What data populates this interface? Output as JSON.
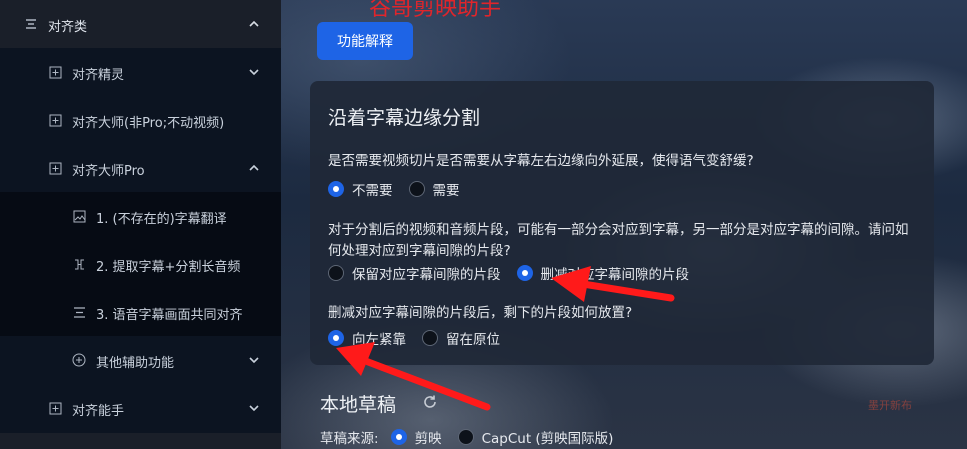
{
  "sidebar": {
    "group": {
      "label": "对齐类",
      "icon": "list-icon"
    },
    "items": [
      {
        "label": "对齐精灵",
        "icon": "plus-box-icon",
        "chevron": "down"
      },
      {
        "label": "对齐大师(非Pro;不动视频)",
        "icon": "plus-box-icon",
        "chevron": ""
      },
      {
        "label": "对齐大师Pro",
        "icon": "plus-box-icon",
        "chevron": "up"
      },
      {
        "label": "1. (不存在的)字幕翻译",
        "icon": "image-icon",
        "chevron": ""
      },
      {
        "label": "2. 提取字幕+分割长音频",
        "icon": "scissors-icon",
        "chevron": ""
      },
      {
        "label": "3. 语音字幕画面共同对齐",
        "icon": "align-icon",
        "chevron": ""
      },
      {
        "label": "其他辅助功能",
        "icon": "plus-circle-icon",
        "chevron": "down"
      },
      {
        "label": "对齐能手",
        "icon": "plus-box-icon",
        "chevron": "down"
      }
    ]
  },
  "main": {
    "watermark": "谷哥剪映助手",
    "explain_button": "功能解释",
    "card": {
      "title": "沿着字幕边缘分割",
      "q1": "是否需要视频切片是否需要从字幕左右边缘向外延展，使得语气变舒缓?",
      "q1_options": [
        "不需要",
        "需要"
      ],
      "q1_selected": 0,
      "q2": "对于分割后的视频和音频片段，可能有一部分会对应到字幕，另一部分是对应字幕的间隙。请问如何处理对应到字幕间隙的片段?",
      "q2_options": [
        "保留对应字幕间隙的片段",
        "删减对应字幕间隙的片段"
      ],
      "q2_selected": 1,
      "q3": "删减对应字幕间隙的片段后，剩下的片段如何放置?",
      "q3_options": [
        "向左紧靠",
        "留在原位"
      ],
      "q3_selected": 0
    },
    "drafts": {
      "title": "本地草稿",
      "source_label": "草稿来源:",
      "source_options": [
        "剪映",
        "CapCut (剪映国际版)"
      ],
      "source_selected": 0
    },
    "corner_mark": "墨开新布"
  },
  "colors": {
    "accent": "#1e64e6",
    "annotation_arrow": "#ff1a1a",
    "sidebar_bg": "#0c1421"
  }
}
